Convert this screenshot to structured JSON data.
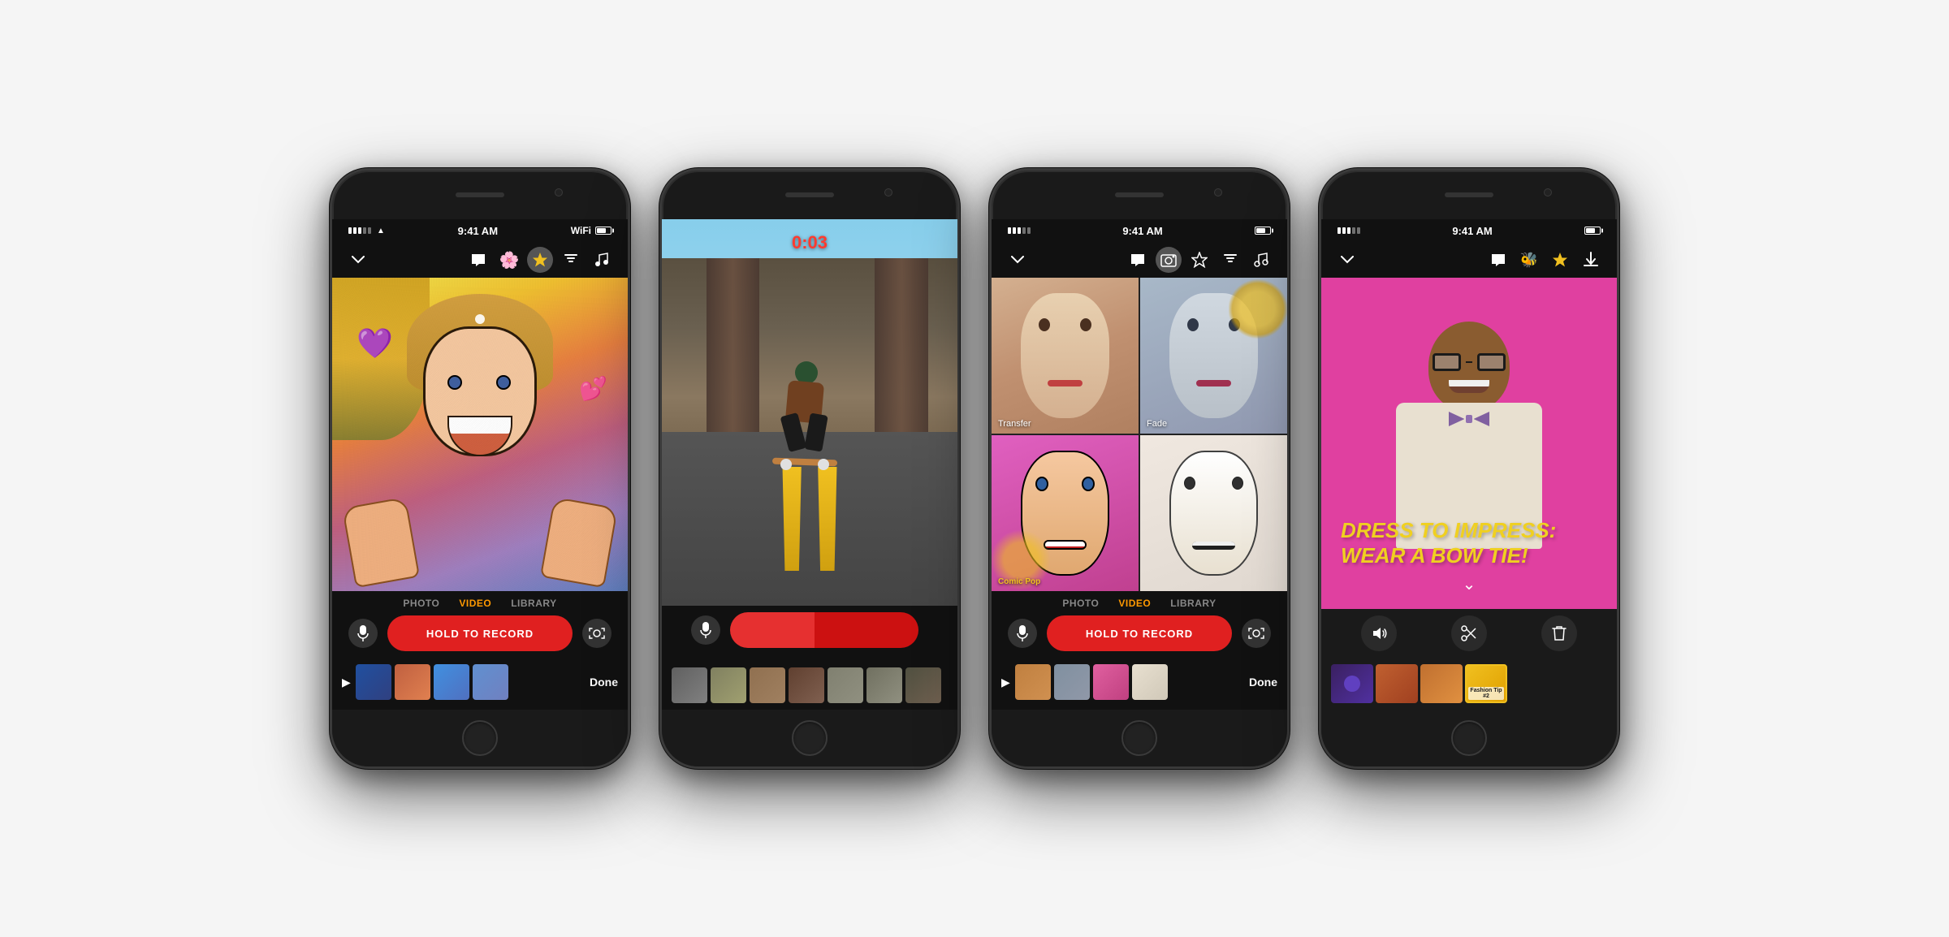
{
  "page": {
    "background": "#f5f5f5"
  },
  "phones": [
    {
      "id": "phone1",
      "status_time": "9:41 AM",
      "toolbar": {
        "chevron": "chevron-down",
        "icons": [
          "chat-bubble",
          "emoji-heart",
          "star",
          "text",
          "music-note"
        ]
      },
      "screen": {
        "type": "camera-cartoon",
        "content_desc": "Woman with cartoon/comic art filter, thumbs up pose, heart emojis",
        "hearts": [
          "💜",
          "💕"
        ]
      },
      "capture_tabs": [
        "PHOTO",
        "VIDEO",
        "LIBRARY"
      ],
      "active_tab": "VIDEO",
      "record_button": "HOLD TO RECORD",
      "filmstrip": {
        "show_play": true,
        "show_done": true,
        "done_label": "Done",
        "thumb_count": 4
      }
    },
    {
      "id": "phone2",
      "status_time": "",
      "toolbar": {
        "show": false
      },
      "screen": {
        "type": "recording-skater",
        "timer": "0:03",
        "content_desc": "Person skateboarding under bridge, yellow road lines visible"
      },
      "capture_tabs": [],
      "record_button_recording": true,
      "filmstrip": {
        "show_play": false,
        "show_done": false,
        "thumb_count": 7
      }
    },
    {
      "id": "phone3",
      "status_time": "9:41 AM",
      "toolbar": {
        "chevron": "chevron-down",
        "icons": [
          "chat-bubble",
          "photo",
          "star",
          "text",
          "music-note"
        ]
      },
      "screen": {
        "type": "filter-grid",
        "filters": [
          {
            "label": "Transfer",
            "bg": "warm-portrait"
          },
          {
            "label": "Fade",
            "bg": "cool-portrait"
          },
          {
            "label": "Comic Pop",
            "bg": "comic-portrait"
          },
          {
            "label": "",
            "bg": "sketch-portrait"
          }
        ]
      },
      "capture_tabs": [
        "PHOTO",
        "VIDEO",
        "LIBRARY"
      ],
      "active_tab": "VIDEO",
      "record_button": "HOLD TO RECORD",
      "filmstrip": {
        "show_play": true,
        "show_done": true,
        "done_label": "Done",
        "thumb_count": 4
      }
    },
    {
      "id": "phone4",
      "status_time": "9:41 AM",
      "toolbar": {
        "chevron": "chevron-down",
        "icons": [
          "chat-bubble",
          "emoji-bee",
          "star",
          "download"
        ]
      },
      "screen": {
        "type": "preview-pink",
        "text_overlay": "DRESS TO IMPRESS: WEAR A BOW TIE!",
        "content_desc": "Man in glasses and bow tie on pink background"
      },
      "edit_buttons": [
        "volume",
        "scissors",
        "trash"
      ],
      "filmstrip": {
        "show_play": false,
        "show_done": false,
        "thumb_count": 4,
        "selected_index": 3
      }
    }
  ]
}
